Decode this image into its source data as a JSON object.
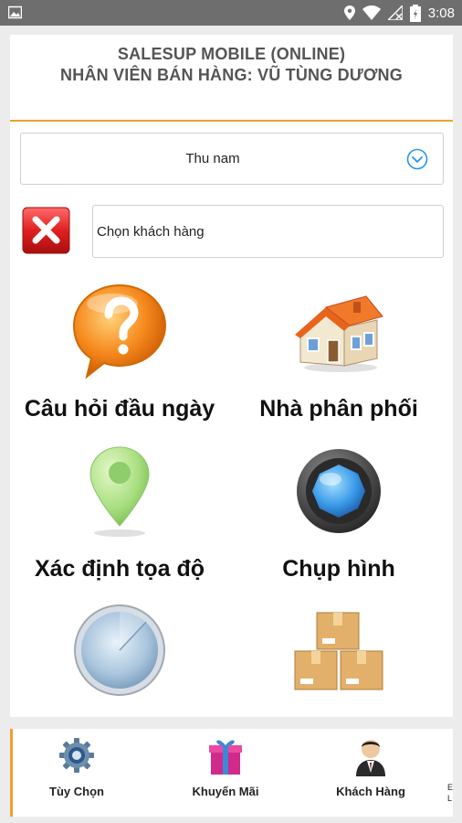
{
  "status_bar": {
    "time": "3:08",
    "icons": [
      "image-icon",
      "location-icon",
      "wifi-icon",
      "no-signal-icon",
      "battery-icon"
    ]
  },
  "header": {
    "line1": "SALESUP MOBILE (ONLINE)",
    "line2": "NHÂN VIÊN BÁN HÀNG: VŨ TÙNG DƯƠNG"
  },
  "dropdown": {
    "selected": "Thu nam",
    "icon": "chevron-down-circle-icon"
  },
  "customer": {
    "value": "Chọn khách hàng",
    "clear_icon": "red-x-icon"
  },
  "tiles": [
    {
      "label": "Câu hỏi đầu ngày",
      "icon": "question-bubble-icon"
    },
    {
      "label": "Nhà phân phối",
      "icon": "house-icon"
    },
    {
      "label": "Xác định tọa độ",
      "icon": "map-pin-icon"
    },
    {
      "label": "Chụp hình",
      "icon": "camera-lens-icon"
    },
    {
      "label": "",
      "icon": "radar-icon"
    },
    {
      "label": "",
      "icon": "boxes-icon"
    }
  ],
  "bottom_nav": [
    {
      "label": "Tùy Chọn",
      "icon": "gear-icon"
    },
    {
      "label": "Khuyến Mãi",
      "icon": "gift-icon"
    },
    {
      "label": "Khách Hàng",
      "icon": "customer-icon"
    }
  ],
  "bottom_nav_more": "E\nL",
  "colors": {
    "accent": "#f0a030",
    "status_bar": "#6e6e6e",
    "header_text": "#555555",
    "dropdown_icon": "#2196f3"
  }
}
